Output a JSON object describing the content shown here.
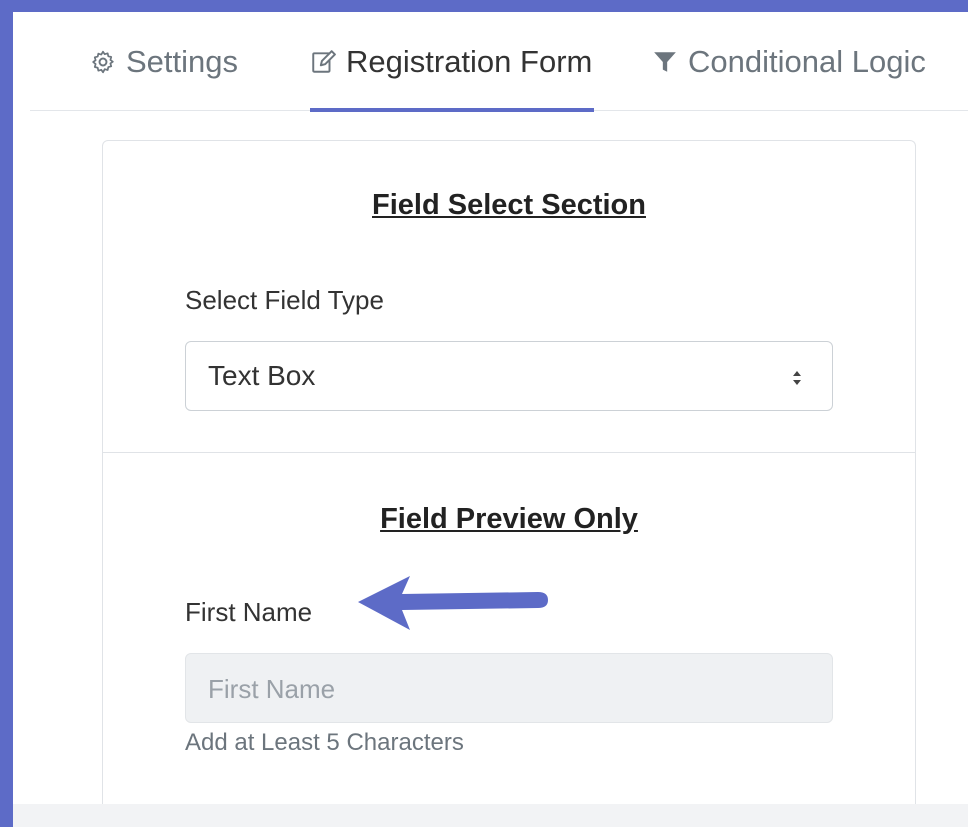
{
  "tabs": [
    {
      "label": "Settings",
      "icon": "gear-icon",
      "active": false
    },
    {
      "label": "Registration Form",
      "icon": "edit-icon",
      "active": true
    },
    {
      "label": "Conditional Logic",
      "icon": "filter-icon",
      "active": false
    }
  ],
  "field_select": {
    "title": "Field Select Section",
    "label": "Select Field Type",
    "selected_value": "Text Box"
  },
  "field_preview": {
    "title": "Field Preview Only",
    "label": "First Name",
    "placeholder": "First Name",
    "help_text": "Add at Least 5 Characters"
  },
  "colors": {
    "accent": "#5d6bc7",
    "border": "#e0e3e7",
    "muted_text": "#6c757d",
    "input_disabled_bg": "#eff1f3"
  }
}
